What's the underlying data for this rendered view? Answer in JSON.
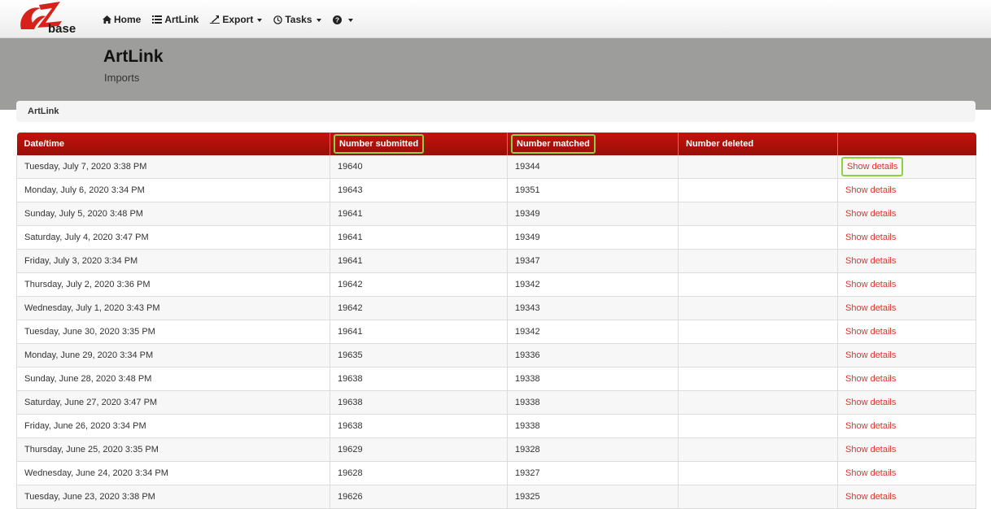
{
  "logo": {
    "text": "base",
    "icon": "ez-logo-icon"
  },
  "nav": {
    "items": [
      {
        "label": "Home",
        "icon": "home-icon",
        "dropdown": false
      },
      {
        "label": "ArtLink",
        "icon": "list-icon",
        "dropdown": false
      },
      {
        "label": "Export",
        "icon": "export-icon",
        "dropdown": true
      },
      {
        "label": "Tasks",
        "icon": "clock-icon",
        "dropdown": true
      },
      {
        "label": "",
        "icon": "help-icon",
        "dropdown": true
      }
    ]
  },
  "header": {
    "title": "ArtLink",
    "subtitle": "Imports"
  },
  "breadcrumb": {
    "current": "ArtLink"
  },
  "colors": {
    "header_red": "#c4130c",
    "link_red": "#d9342b",
    "highlight_green": "#8bd23f",
    "band_gray": "#9d9d9b"
  },
  "table": {
    "columns": [
      "Date/time",
      "Number submitted",
      "Number matched",
      "Number deleted",
      ""
    ],
    "highlighted_columns": [
      1,
      2
    ],
    "highlighted_link_row": 0,
    "rows": [
      {
        "datetime": "Tuesday, July 7, 2020 3:38 PM",
        "submitted": "19640",
        "matched": "19344",
        "deleted": "",
        "action": "Show details"
      },
      {
        "datetime": "Monday, July 6, 2020 3:34 PM",
        "submitted": "19643",
        "matched": "19351",
        "deleted": "",
        "action": "Show details"
      },
      {
        "datetime": "Sunday, July 5, 2020 3:48 PM",
        "submitted": "19641",
        "matched": "19349",
        "deleted": "",
        "action": "Show details"
      },
      {
        "datetime": "Saturday, July 4, 2020 3:47 PM",
        "submitted": "19641",
        "matched": "19349",
        "deleted": "",
        "action": "Show details"
      },
      {
        "datetime": "Friday, July 3, 2020 3:34 PM",
        "submitted": "19641",
        "matched": "19347",
        "deleted": "",
        "action": "Show details"
      },
      {
        "datetime": "Thursday, July 2, 2020 3:36 PM",
        "submitted": "19642",
        "matched": "19342",
        "deleted": "",
        "action": "Show details"
      },
      {
        "datetime": "Wednesday, July 1, 2020 3:43 PM",
        "submitted": "19642",
        "matched": "19343",
        "deleted": "",
        "action": "Show details"
      },
      {
        "datetime": "Tuesday, June 30, 2020 3:35 PM",
        "submitted": "19641",
        "matched": "19342",
        "deleted": "",
        "action": "Show details"
      },
      {
        "datetime": "Monday, June 29, 2020 3:34 PM",
        "submitted": "19635",
        "matched": "19336",
        "deleted": "",
        "action": "Show details"
      },
      {
        "datetime": "Sunday, June 28, 2020 3:48 PM",
        "submitted": "19638",
        "matched": "19338",
        "deleted": "",
        "action": "Show details"
      },
      {
        "datetime": "Saturday, June 27, 2020 3:47 PM",
        "submitted": "19638",
        "matched": "19338",
        "deleted": "",
        "action": "Show details"
      },
      {
        "datetime": "Friday, June 26, 2020 3:34 PM",
        "submitted": "19638",
        "matched": "19338",
        "deleted": "",
        "action": "Show details"
      },
      {
        "datetime": "Thursday, June 25, 2020 3:35 PM",
        "submitted": "19629",
        "matched": "19328",
        "deleted": "",
        "action": "Show details"
      },
      {
        "datetime": "Wednesday, June 24, 2020 3:34 PM",
        "submitted": "19628",
        "matched": "19327",
        "deleted": "",
        "action": "Show details"
      },
      {
        "datetime": "Tuesday, June 23, 2020 3:38 PM",
        "submitted": "19626",
        "matched": "19325",
        "deleted": "",
        "action": "Show details"
      }
    ]
  }
}
